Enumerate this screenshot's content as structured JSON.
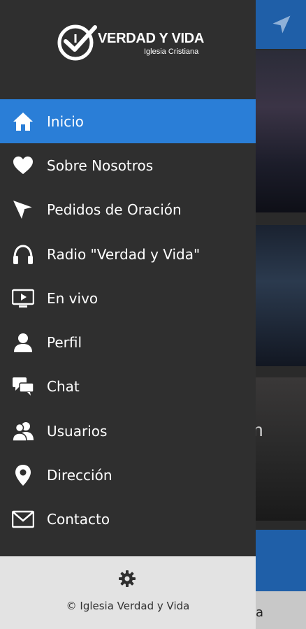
{
  "colors": {
    "drawer_bg": "#2f2f2f",
    "active_item": "#2a7ed7",
    "footer_bg": "#e3e3e3",
    "app_bar": "#1f5fa8"
  },
  "logo": {
    "title": "VERDAD Y VIDA",
    "subtitle": "Iglesia Cristiana"
  },
  "menu": {
    "items": [
      {
        "label": "Inicio",
        "icon": "home-icon",
        "active": true
      },
      {
        "label": "Sobre Nosotros",
        "icon": "heart-icon"
      },
      {
        "label": "Pedidos de Oración",
        "icon": "paper-plane-icon"
      },
      {
        "label": "Radio \"Verdad y Vida\"",
        "icon": "headphones-icon"
      },
      {
        "label": "En vivo",
        "icon": "tv-icon"
      },
      {
        "label": "Perfil",
        "icon": "user-icon"
      },
      {
        "label": "Chat",
        "icon": "chat-icon"
      },
      {
        "label": "Usuarios",
        "icon": "users-icon"
      },
      {
        "label": "Dirección",
        "icon": "location-pin-icon"
      },
      {
        "label": "Contacto",
        "icon": "envelope-icon"
      }
    ]
  },
  "footer": {
    "settings_icon": "gear-icon",
    "copyright": "© Iglesia Verdad y Vida"
  },
  "background": {
    "send_icon": "send-icon",
    "card3_partial_text": "n",
    "bottom_partial_text": "a"
  }
}
